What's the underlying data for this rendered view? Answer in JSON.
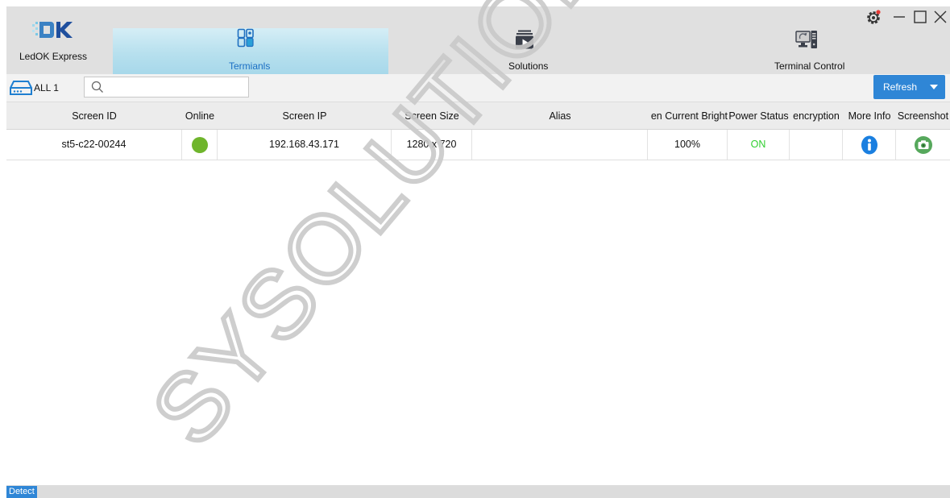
{
  "app": {
    "name": "LedOK Express",
    "accent": "#2f86d6"
  },
  "nav": {
    "tabs": [
      {
        "label": "Termianls",
        "icon": "terminals-icon",
        "active": true
      },
      {
        "label": "Solutions",
        "icon": "solutions-play-icon",
        "active": false
      },
      {
        "label": "Terminal Control",
        "icon": "terminal-control-icon",
        "active": false
      }
    ]
  },
  "toolbar": {
    "group_label": "ALL 1",
    "search_placeholder": "",
    "search_value": "",
    "refresh_label": "Refresh"
  },
  "table": {
    "columns": [
      "Screen ID",
      "Online",
      "Screen IP",
      "Screen Size",
      "Alias",
      "en Current Bright",
      "Power Status",
      "encryption",
      "More Info",
      "Screenshot"
    ],
    "rows": [
      {
        "screen_id": "st5-c22-00244",
        "online": true,
        "screen_ip": "192.168.43.171",
        "screen_size": "1280 x 720",
        "alias": "",
        "brightness": "100%",
        "power_status": "ON",
        "encryption": ""
      }
    ]
  },
  "status": {
    "detect_label": "Detect"
  },
  "watermark": {
    "text": "SYSOLUTION TECH"
  }
}
